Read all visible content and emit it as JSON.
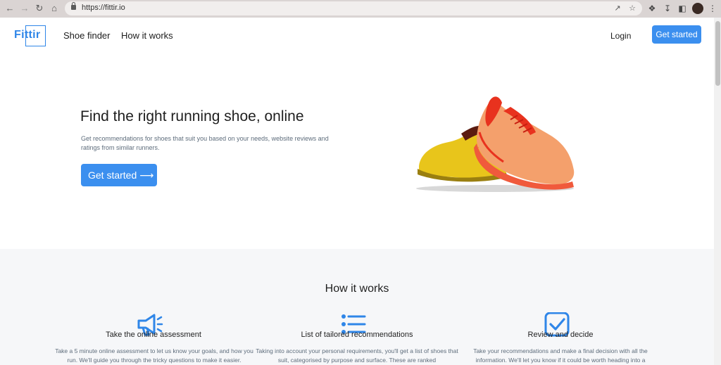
{
  "browser": {
    "url": "https://fittir.io",
    "nav_icons": [
      "back-arrow-icon",
      "forward-arrow-icon",
      "reload-icon",
      "home-icon"
    ],
    "toolbar_icons": [
      "share-icon",
      "star-icon",
      "extensions-icon",
      "download-icon",
      "sidebar-icon",
      "profile-avatar",
      "menu-icon"
    ]
  },
  "header": {
    "logo": "Fittir",
    "nav": [
      "Shoe finder",
      "How it works"
    ],
    "login": "Login",
    "cta": "Get started"
  },
  "hero": {
    "title": "Find the right running shoe, online",
    "subtitle": "Get recommendations for shoes that suit you based on your needs, website reviews and ratings from similar runners.",
    "cta": "Get started",
    "cta_arrow": "⟶"
  },
  "how_it_works": {
    "title": "How it works",
    "steps": [
      {
        "icon": "megaphone-icon",
        "title": "Take the online assessment",
        "text": "Take a 5 minute online assessment to let us know your goals, and how you run. We'll guide you through the tricky questions to make it easier."
      },
      {
        "icon": "list-icon",
        "title": "List of tailored recommendations",
        "text": "Taking into account your personal requirements, you'll get a list of shoes that suit, categorised by purpose and surface. These are ranked"
      },
      {
        "icon": "checkbox-icon",
        "title": "Review and decide",
        "text": "Take your recommendations and make a final decision with all the information. We'll let you know if it could be worth heading into a"
      }
    ]
  },
  "colors": {
    "brand": "#2f86e8",
    "button": "#3b8fef",
    "section_bg": "#f6f7f9"
  }
}
